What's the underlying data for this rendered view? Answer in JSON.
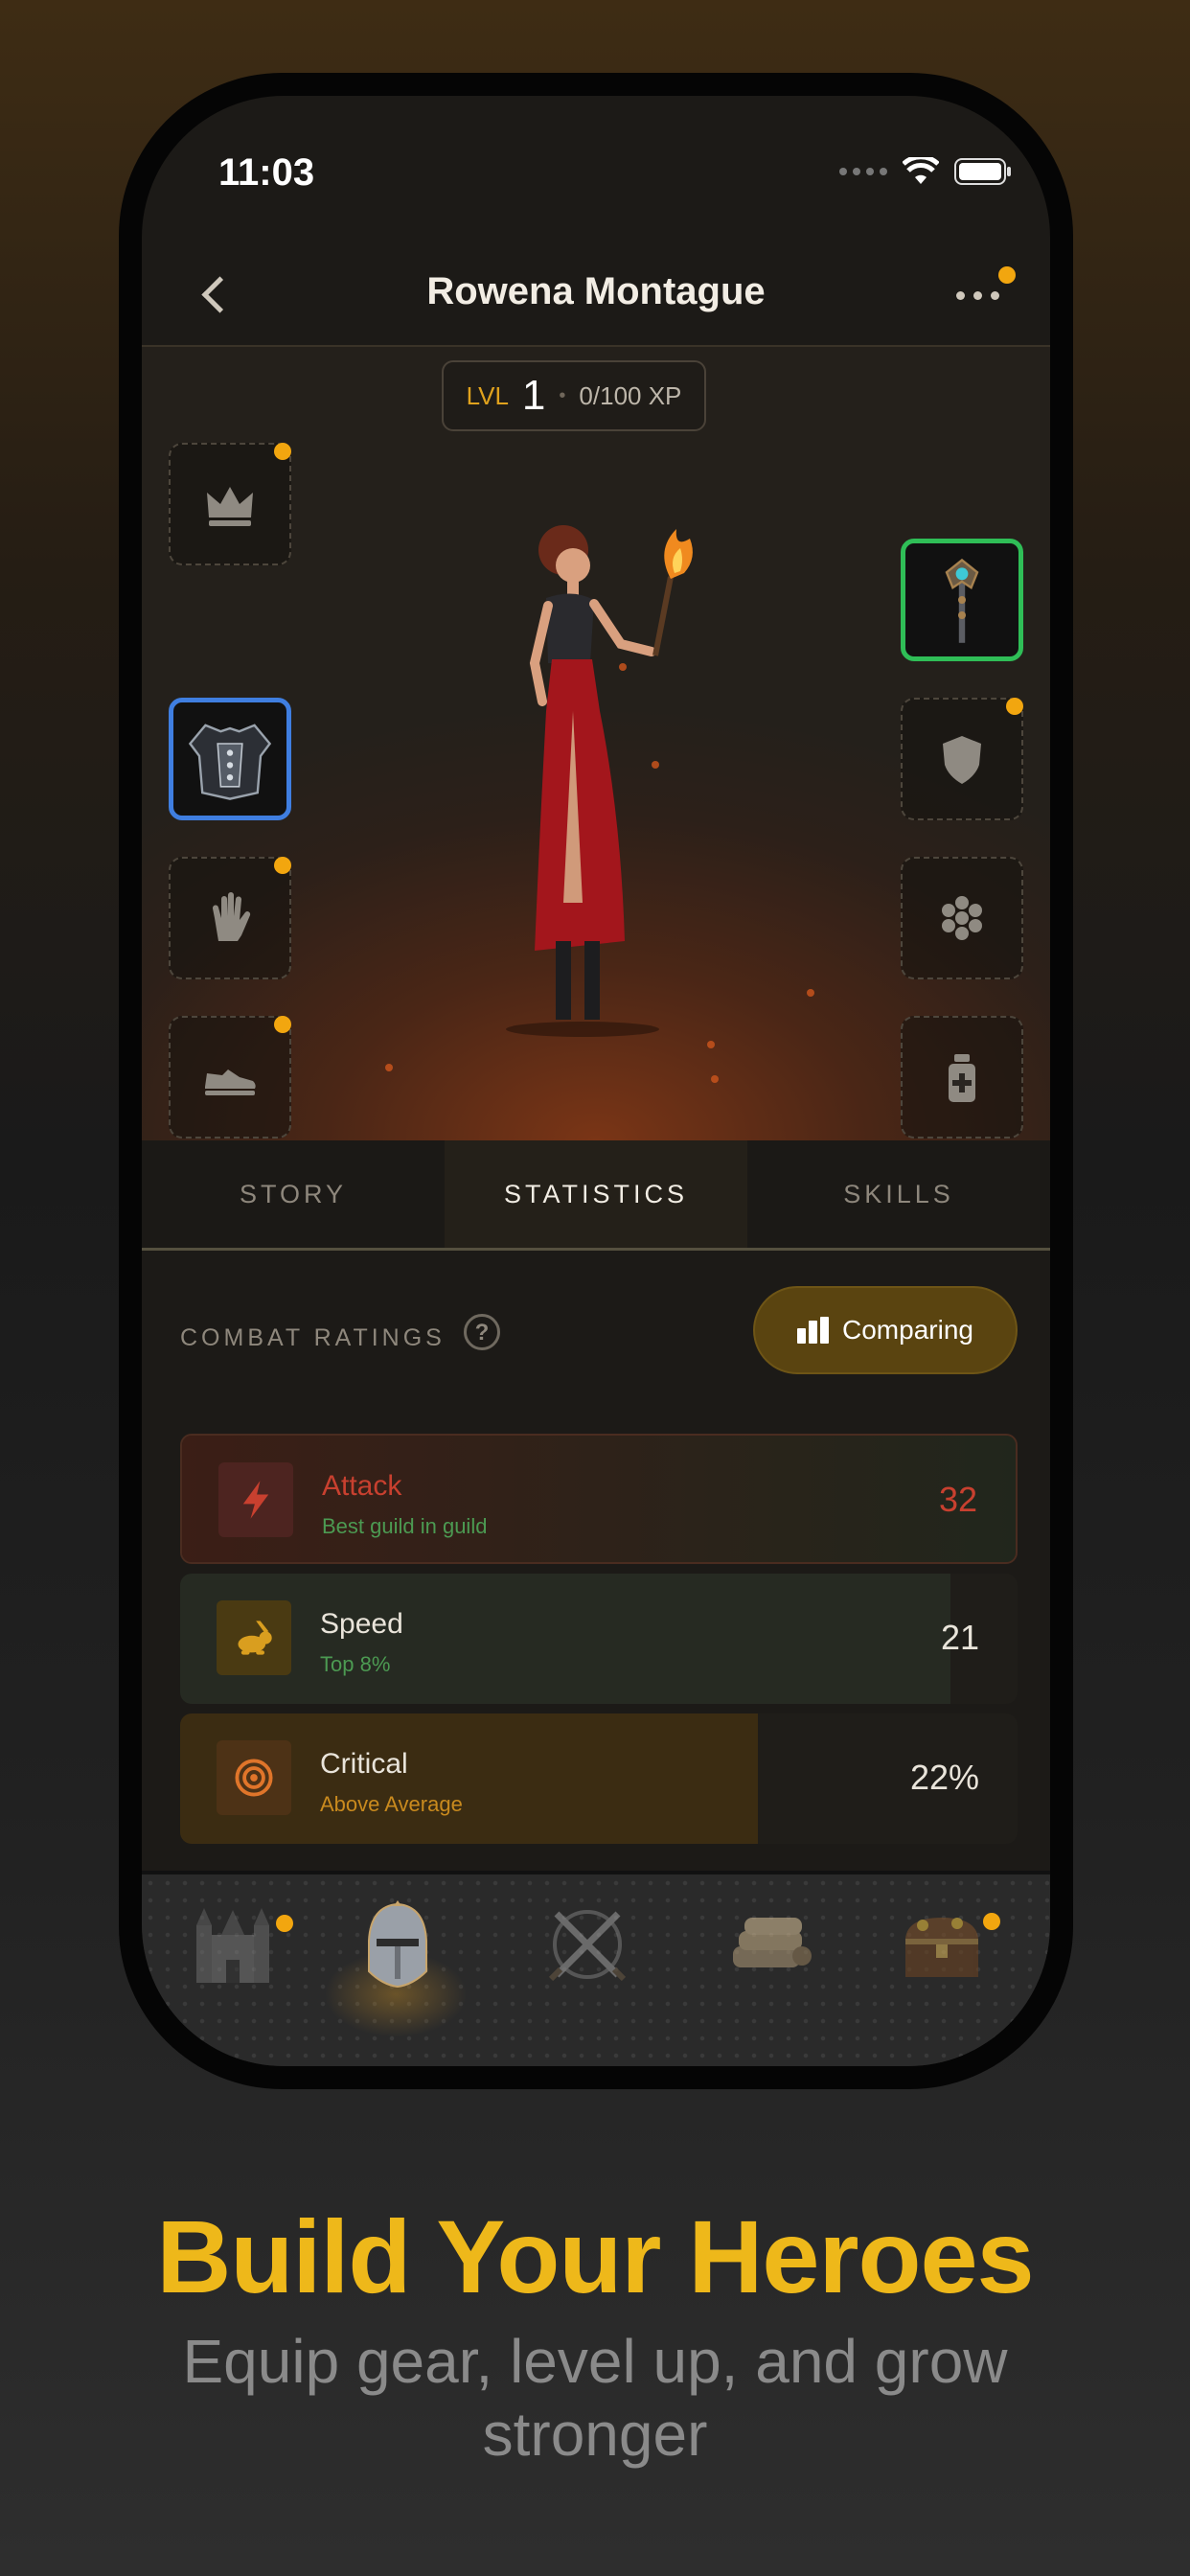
{
  "status_bar": {
    "time": "11:03"
  },
  "nav": {
    "title": "Rowena Montague"
  },
  "level": {
    "label": "LVL",
    "value": "1",
    "separator": "•",
    "xp": "0/100 XP"
  },
  "slots": {
    "left": [
      {
        "icon": "crown-icon",
        "equipped": false,
        "badge": true
      },
      {
        "icon": "chest-armor-icon",
        "equipped": true,
        "badge": false
      },
      {
        "icon": "glove-icon",
        "equipped": false,
        "badge": true
      },
      {
        "icon": "boot-icon",
        "equipped": false,
        "badge": true
      }
    ],
    "right": [
      {
        "icon": "staff-icon",
        "equipped": true,
        "badge": false
      },
      {
        "icon": "shield-icon",
        "equipped": false,
        "badge": true
      },
      {
        "icon": "ring-cluster-icon",
        "equipped": false,
        "badge": false
      },
      {
        "icon": "potion-icon",
        "equipped": false,
        "badge": false
      }
    ]
  },
  "tabs": {
    "story": "STORY",
    "statistics": "STATISTICS",
    "skills": "SKILLS",
    "active": "statistics"
  },
  "combat": {
    "label": "COMBAT RATINGS",
    "help": "?",
    "compare_label": "Comparing",
    "stats": [
      {
        "name": "Attack",
        "sub": "Best guild in guild",
        "value": "32",
        "icon": "lightning-icon",
        "color": "#c8402f",
        "sub_color": "#4c9a52",
        "fill": 1.0
      },
      {
        "name": "Speed",
        "sub": "Top 8%",
        "value": "21",
        "icon": "rabbit-icon",
        "color": "#e9e4da",
        "sub_color": "#4c9a52",
        "fill": 0.92
      },
      {
        "name": "Critical",
        "sub": "Above Average",
        "value": "22%",
        "icon": "target-icon",
        "color": "#e9e4da",
        "sub_color": "#c98a1e",
        "fill": 0.69
      }
    ]
  },
  "bottom_nav": [
    "castle-icon",
    "knight-helmet-icon",
    "crossed-swords-icon",
    "scrolls-icon",
    "treasure-chest-icon"
  ],
  "marketing": {
    "headline": "Build Your Heroes",
    "subline": "Equip gear, level up, and grow stronger"
  }
}
